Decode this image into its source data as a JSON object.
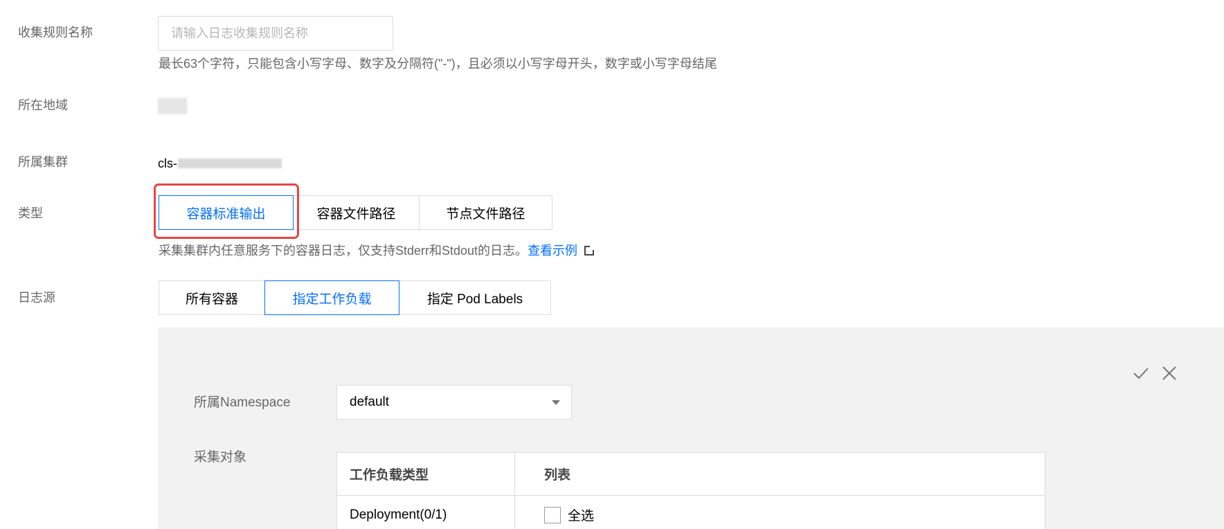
{
  "form": {
    "rule_name": {
      "label": "收集规则名称",
      "placeholder": "请输入日志收集规则名称",
      "value": "",
      "hint": "最长63个字符，只能包含小写字母、数字及分隔符(\"-\")，且必须以小写字母开头，数字或小写字母结尾"
    },
    "region": {
      "label": "所在地域"
    },
    "cluster": {
      "label": "所属集群",
      "value_prefix": "cls-"
    },
    "type": {
      "label": "类型",
      "options": [
        "容器标准输出",
        "容器文件路径",
        "节点文件路径"
      ],
      "selected": "容器标准输出",
      "description": "采集集群内任意服务下的容器日志，仅支持Stderr和Stdout的日志。",
      "example_link": "查看示例"
    },
    "log_source": {
      "label": "日志源",
      "options": [
        "所有容器",
        "指定工作负载",
        "指定 Pod Labels"
      ],
      "selected": "指定工作负载"
    }
  },
  "panel": {
    "namespace_label": "所属Namespace",
    "namespace_value": "default",
    "collect_target_label": "采集对象",
    "confirm_icon": "check-icon",
    "cancel_icon": "close-icon",
    "table": {
      "headers": [
        "工作负载类型",
        "列表"
      ],
      "rows": [
        {
          "type": "Deployment(0/1)",
          "select_all_label": "全选"
        }
      ]
    }
  },
  "colors": {
    "accent": "#006eff",
    "highlight": "#e54545",
    "panel_bg": "#f2f2f2"
  }
}
